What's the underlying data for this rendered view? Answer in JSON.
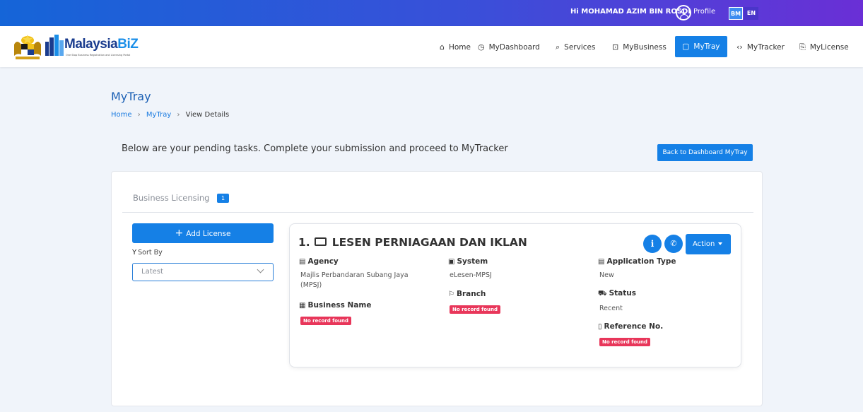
{
  "topbar": {
    "greeting": "Hi MOHAMAD AZIM BIN ROSDI",
    "profile_label": "Profile",
    "lang_bm": "BM",
    "lang_en": "EN"
  },
  "brand": {
    "name_main": "Malaysia",
    "name_accent": "BiZ",
    "tagline": "One Stop Business Registration and Licensing Portal"
  },
  "nav": {
    "home": "Home",
    "dashboard": "MyDashboard",
    "services": "Services",
    "business": "MyBusiness",
    "tray": "MyTray",
    "tracker": "MyTracker",
    "license": "MyLicense"
  },
  "page": {
    "title": "MyTray",
    "breadcrumb": [
      "Home",
      "MyTray",
      "View Details"
    ],
    "intro": "Below are your pending tasks. Complete your submission and proceed to MyTracker",
    "back_button": "Back to Dashboard MyTray"
  },
  "tab": {
    "label": "Business Licensing",
    "count": "1"
  },
  "sidebar": {
    "add_button": "Add License",
    "sort_label": "Sort By",
    "sort_value": "Latest"
  },
  "license": {
    "index": "1.",
    "title": "LESEN PERNIAGAAN DAN IKLAN",
    "action_label": "Action",
    "agency_label": "Agency",
    "agency_value": "Majlis Perbandaran Subang Jaya (MPSJ)",
    "business_name_label": "Business Name",
    "business_name_value": "No record found",
    "system_label": "System",
    "system_value": "eLesen-MPSJ",
    "branch_label": "Branch",
    "branch_value": "No record found",
    "application_type_label": "Application Type",
    "application_type_value": "New",
    "status_label": "Status",
    "status_value": "Recent",
    "reference_label": "Reference No.",
    "reference_value": "No record found"
  },
  "colors": {
    "primary": "#1580e6",
    "badge_red": "#e8365a",
    "title_blue": "#1a5fb4"
  }
}
